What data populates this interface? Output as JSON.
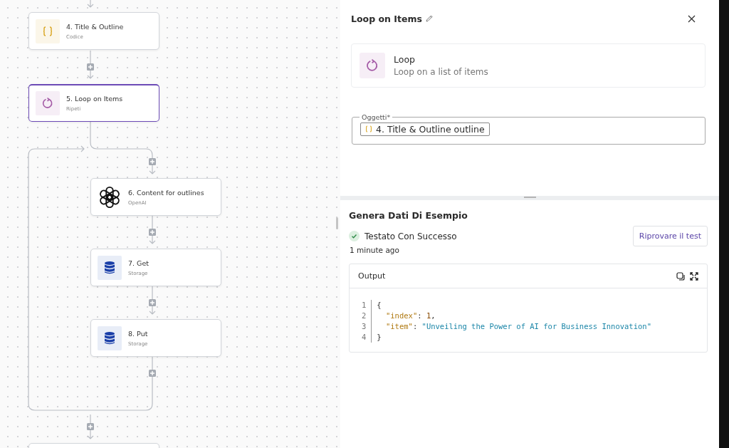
{
  "flow": {
    "nodes": [
      {
        "title": "4. Title & Outline",
        "subtitle": "Codice",
        "kind": "code",
        "selected": false
      },
      {
        "title": "5. Loop on Items",
        "subtitle": "Ripeti",
        "kind": "loop",
        "selected": true,
        "children": [
          {
            "title": "6. Content for outlines",
            "subtitle": "OpenAI",
            "kind": "openai",
            "selected": false
          },
          {
            "title": "7. Get",
            "subtitle": "Storage",
            "kind": "storage",
            "selected": false
          },
          {
            "title": "8. Put",
            "subtitle": "Storage",
            "kind": "storage",
            "selected": false
          }
        ]
      }
    ]
  },
  "panel": {
    "title": "Loop on Items",
    "step": {
      "name": "Loop",
      "description": "Loop on a list of items"
    },
    "field": {
      "label": "Oggetti*",
      "chip": "4. Title & Outline outline"
    },
    "test": {
      "heading": "Genera Dati Di Esempio",
      "status": "Testato Con Successo",
      "time": "1 minute ago",
      "button": "Riprovare il test",
      "output": {
        "title": "Output",
        "lines": [
          {
            "number": "1",
            "tokens": [
              {
                "kind": "punct",
                "text": "{"
              }
            ]
          },
          {
            "number": "2",
            "tokens": [
              {
                "kind": "key",
                "text": "  \"index\""
              },
              {
                "kind": "punct",
                "text": ": "
              },
              {
                "kind": "number",
                "text": "1"
              },
              {
                "kind": "punct",
                "text": ","
              }
            ]
          },
          {
            "number": "3",
            "tokens": [
              {
                "kind": "key",
                "text": "  \"item\""
              },
              {
                "kind": "punct",
                "text": ": "
              },
              {
                "kind": "string",
                "text": "\"Unveiling the Power of AI for Business Innovation\""
              }
            ]
          },
          {
            "number": "4",
            "tokens": [
              {
                "kind": "punct",
                "text": "}"
              }
            ]
          }
        ]
      }
    }
  }
}
